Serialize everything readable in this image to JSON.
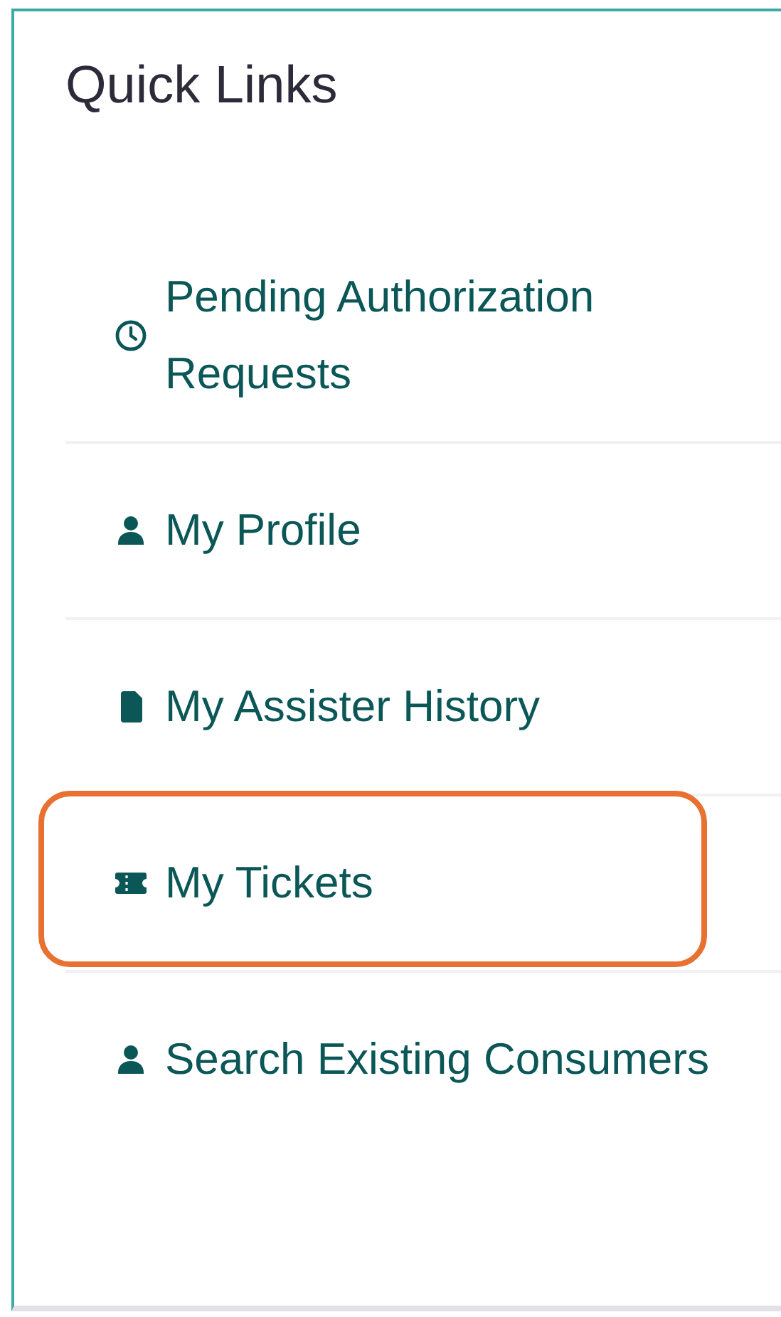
{
  "panel": {
    "title": "Quick Links",
    "items": [
      {
        "label": "Pending Authorization Requests",
        "highlighted": false
      },
      {
        "label": "My Profile",
        "highlighted": false
      },
      {
        "label": "My Assister History",
        "highlighted": false
      },
      {
        "label": "My Tickets",
        "highlighted": true
      },
      {
        "label": "Search Existing Consumers",
        "highlighted": false
      }
    ]
  }
}
